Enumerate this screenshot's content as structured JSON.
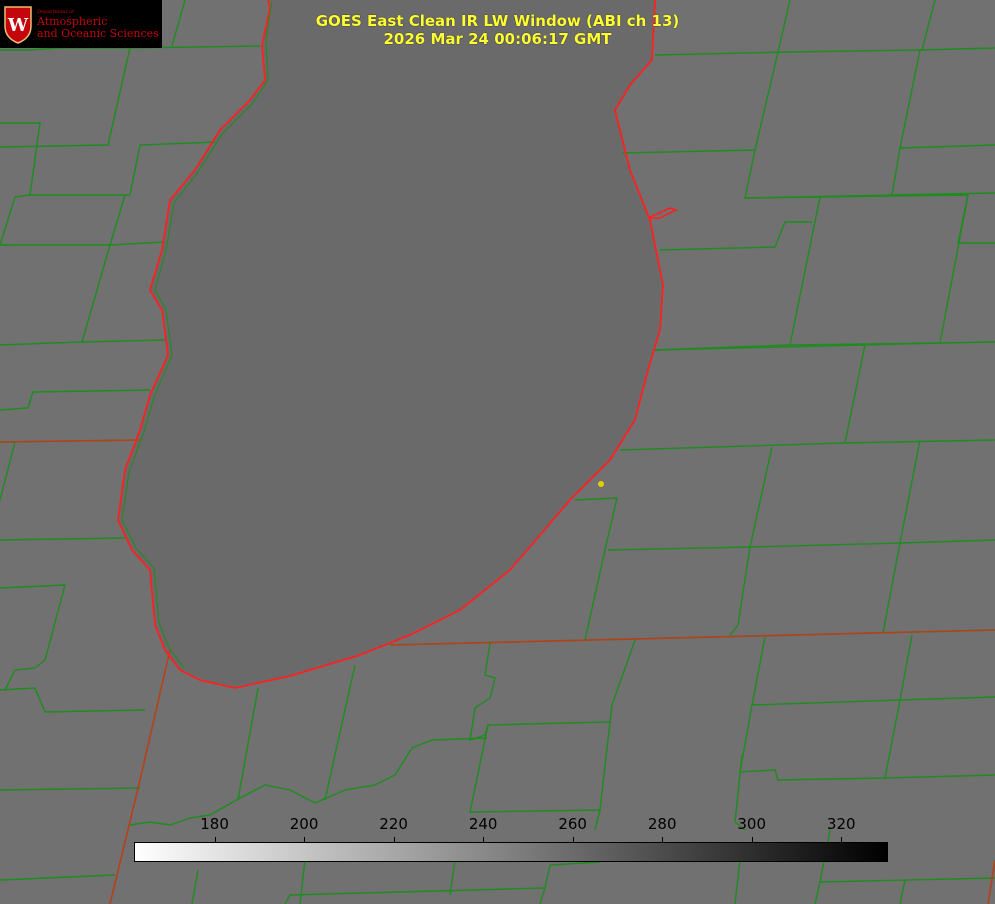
{
  "title": {
    "line1": "GOES East Clean IR LW Window (ABI ch 13)",
    "line2": "2026 Mar 24 00:06:17 GMT"
  },
  "logo": {
    "dept": "Department of",
    "line1": "Atmospheric",
    "line2": "and Oceanic Sciences",
    "seal_letter": "W"
  },
  "colorbar": {
    "ticks": [
      "180",
      "200",
      "220",
      "240",
      "260",
      "280",
      "300",
      "320"
    ],
    "tick_values": [
      180,
      200,
      220,
      240,
      260,
      280,
      300,
      320
    ],
    "range": [
      162,
      330
    ],
    "gradient": [
      "#ffffff",
      "#000000"
    ]
  },
  "colors": {
    "county_lines": "#1e8c1e",
    "coast_lines": "#ff2020",
    "title_text": "#ffff33",
    "marker": "#e0d000"
  }
}
